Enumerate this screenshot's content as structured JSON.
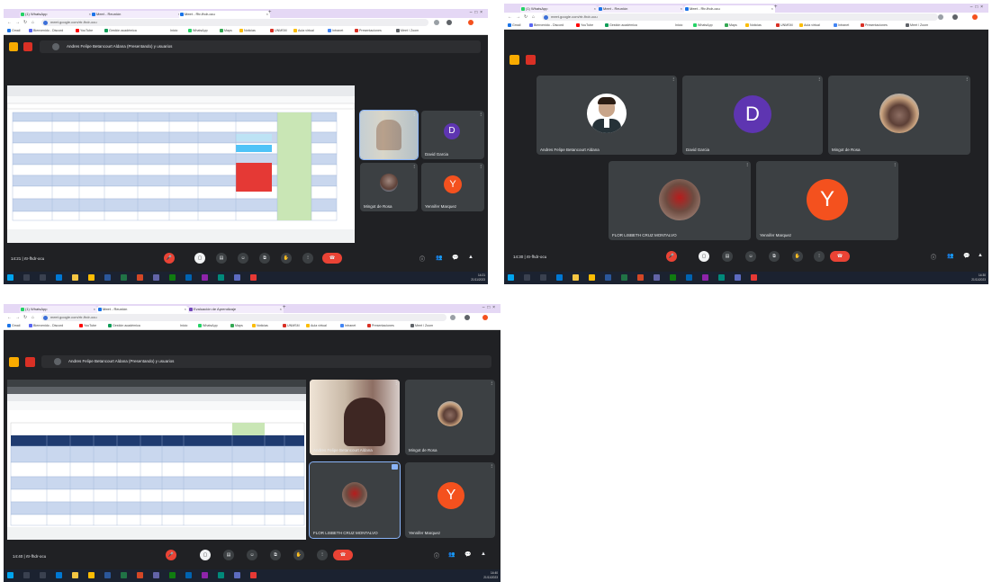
{
  "colors": {
    "accent": "#8ab4f8",
    "danger": "#ea4335",
    "avatar_purple": "#5e35b1",
    "avatar_orange": "#f4511e",
    "meet_bg": "#202124",
    "tile_bg": "#3c4043"
  },
  "browser": {
    "tab1": "(1) WhatsApp",
    "tab2": "Meet - Reunión",
    "tab3": "Meet - Rtr-fhdr-ocu",
    "tab4": "Evaluación de Aprendizaje",
    "url": "meet.google.com/rtr-fhdr-ocu",
    "bookmarks": [
      "Gmail",
      "Bienvenido - Discord",
      "YouTube",
      "Inicio",
      "Gestión académica",
      "WhatsApp",
      "Maps",
      "Noticias",
      "Traductor",
      "UNMSM",
      "Aula virtual",
      "Intranet",
      "Drive",
      "Presentaciones",
      "Meet / Zoom"
    ]
  },
  "meet": {
    "presenting_banner": "Andres Felipe Betancourt Aldana (Presentando) y usuarios",
    "meeting_code": "rtr-fhdr-ocu",
    "time1": "14:21",
    "time2": "14:30",
    "time3": "14:40",
    "participants": [
      {
        "name": "Andres Felipe Betancourt Aldana"
      },
      {
        "name": "David Garcia",
        "initial": "D"
      },
      {
        "name": "Mingot de Rosa"
      },
      {
        "name": "FLOR LISBETH CRUZ MONTALVO"
      },
      {
        "name": "Yennifer Marquez",
        "initial": "Y"
      }
    ]
  },
  "taskbar": {
    "time": "14:21",
    "date": "21/11/2023",
    "time2": "14:30",
    "time3": "14:40"
  }
}
